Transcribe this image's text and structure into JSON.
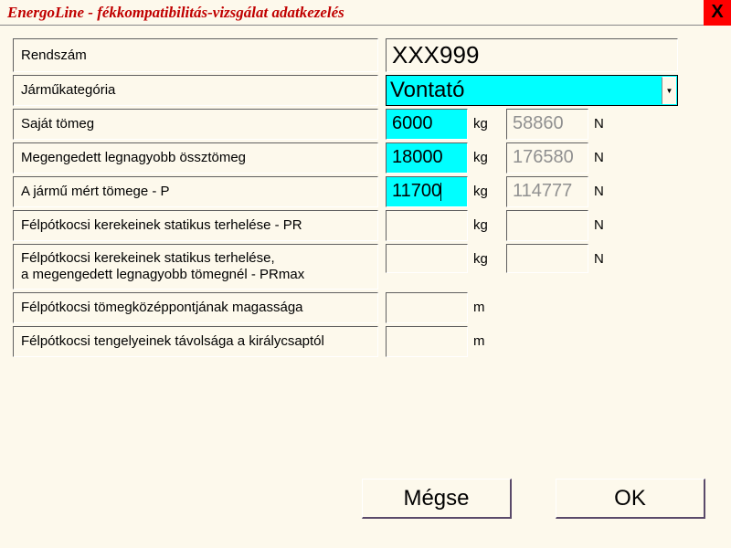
{
  "titlebar": {
    "title": "EnergoLine  -  fékkompatibilitás-vizsgálat adatkezelés",
    "close": "X"
  },
  "labels": {
    "rendszam": "Rendszám",
    "kategoria": "Járműkategória",
    "sajat_tomeg": "Saját tömeg",
    "megengedett": "Megengedett legnagyobb össztömeg",
    "mert_tomeg": "A jármű mért tömege - P",
    "pr": "Félpótkocsi kerekeinek statikus terhelése - PR",
    "prmax": "Félpótkocsi kerekeinek statikus terhelése,\na megengedett legnagyobb tömegnél - PRmax",
    "magassag": "Félpótkocsi tömegközéppontjának magassága",
    "tavolsag": "Félpótkocsi tengelyeinek távolsága a királycsaptól"
  },
  "values": {
    "rendszam": "XXX999",
    "kategoria": "Vontató",
    "sajat_tomeg_kg": "6000",
    "sajat_tomeg_n": "58860",
    "megengedett_kg": "18000",
    "megengedett_n": "176580",
    "mert_tomeg_kg": "11700",
    "mert_tomeg_n": "114777",
    "pr_kg": "",
    "pr_n": "",
    "prmax_kg": "",
    "prmax_n": "",
    "magassag_m": "",
    "tavolsag_m": ""
  },
  "units": {
    "kg": "kg",
    "n": "N",
    "m": "m"
  },
  "buttons": {
    "cancel": "Mégse",
    "ok": "OK"
  }
}
